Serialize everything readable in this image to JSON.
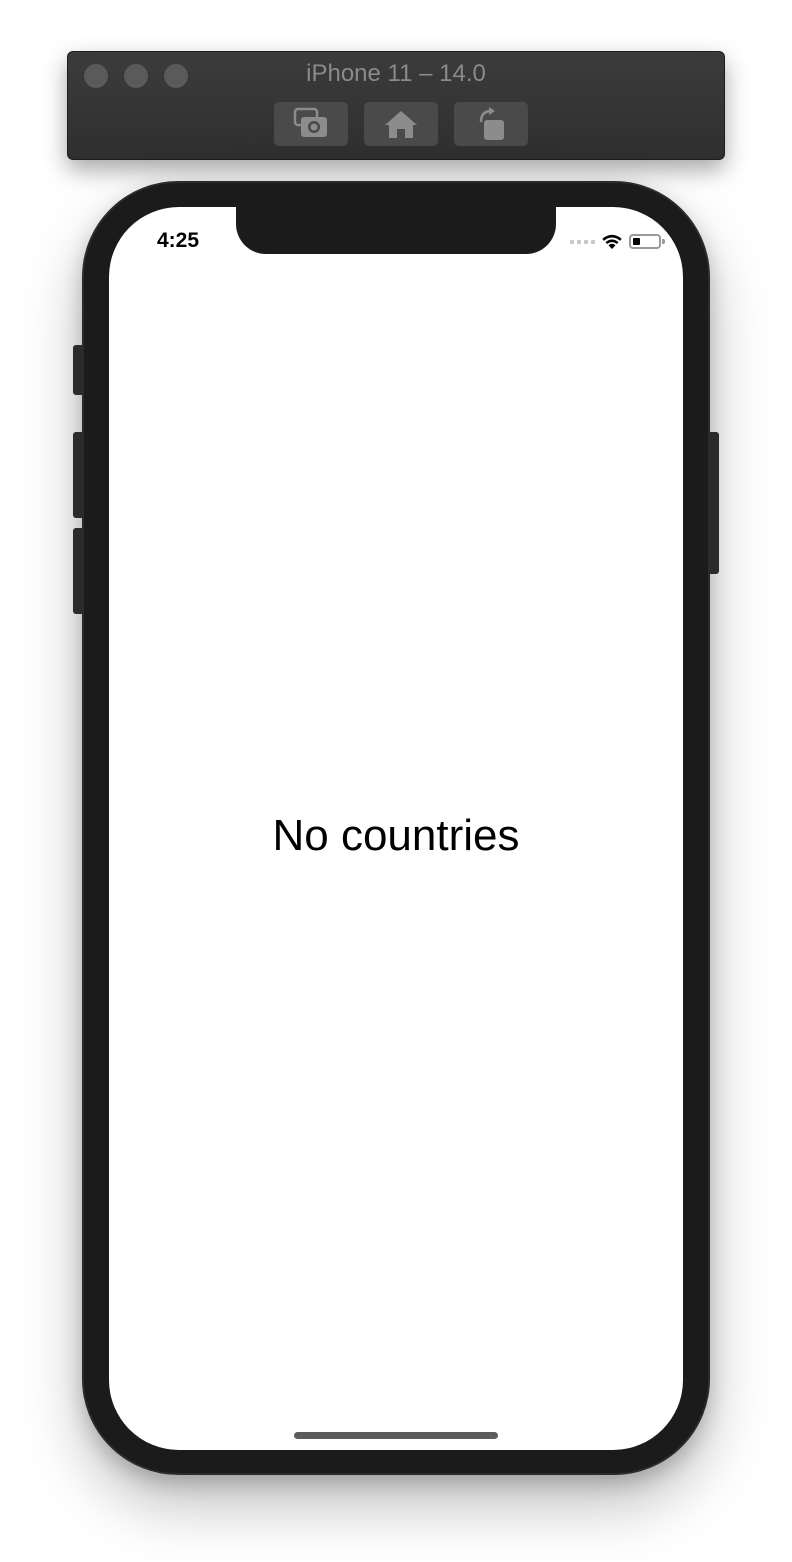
{
  "simulator": {
    "title": "iPhone 11 – 14.0",
    "toolbar": [
      {
        "icon": "screenshot-icon"
      },
      {
        "icon": "home-icon"
      },
      {
        "icon": "rotate-icon"
      }
    ]
  },
  "status_bar": {
    "time": "4:25",
    "icons": [
      "cellular-signal-icon",
      "wifi-icon",
      "battery-icon"
    ],
    "battery_level": 0.3
  },
  "main": {
    "empty_message": "No countries"
  },
  "colors": {
    "frame": "#1b1b1b",
    "screen_background": "#ffffff",
    "toolbar_background": "#333333"
  }
}
